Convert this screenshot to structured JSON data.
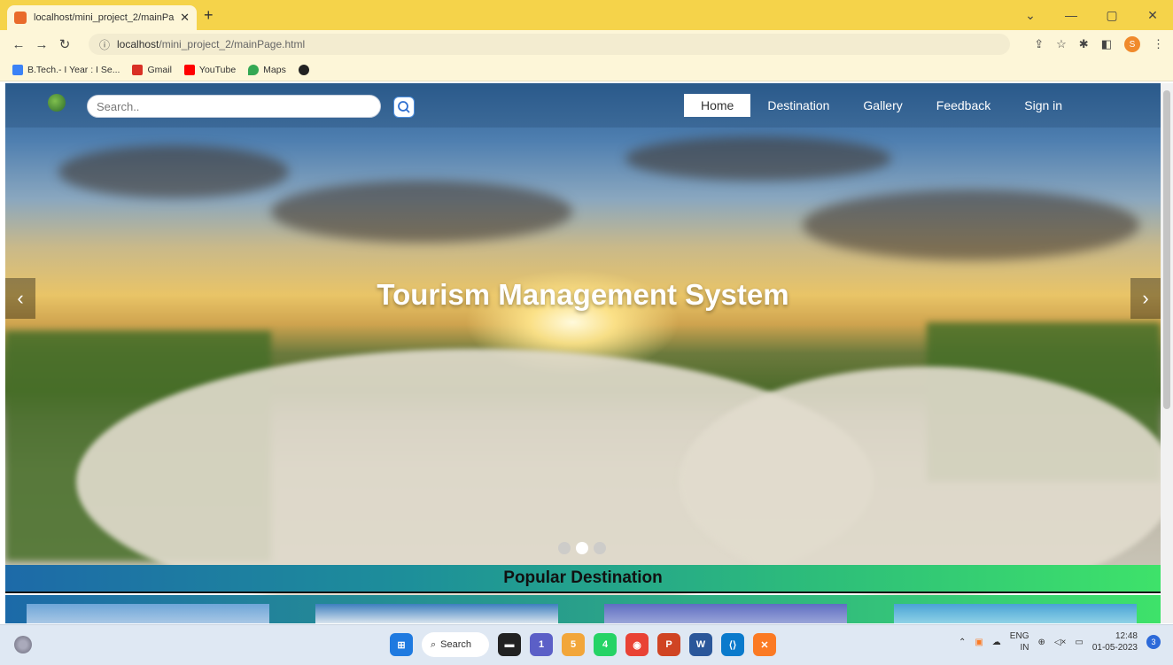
{
  "browser": {
    "tab_title": "localhost/mini_project_2/mainPa",
    "url_host": "localhost",
    "url_path": "/mini_project_2/mainPage.html",
    "bookmarks": [
      {
        "label": "B.Tech.- I Year : I Se...",
        "icon": "classroom-icon",
        "color": "#3b82f6"
      },
      {
        "label": "Gmail",
        "icon": "gmail-icon",
        "color": "#d93025"
      },
      {
        "label": "YouTube",
        "icon": "youtube-icon",
        "color": "#ff0000"
      },
      {
        "label": "Maps",
        "icon": "maps-icon",
        "color": "#34a853"
      }
    ],
    "profile_initial": "S"
  },
  "site": {
    "search_placeholder": "Search..",
    "nav": [
      "Home",
      "Destination",
      "Gallery",
      "Feedback",
      "Sign in"
    ],
    "active_nav": "Home",
    "hero_title": "Tourism Management System",
    "prev_arrow": "‹",
    "next_arrow": "›",
    "section_title": "Popular Destination"
  },
  "taskbar": {
    "search_label": "Search",
    "lang_top": "ENG",
    "lang_bottom": "IN",
    "time": "12:48",
    "date": "01-05-2023",
    "notification_count": "3",
    "badges": [
      "5",
      "1",
      "4"
    ]
  },
  "colors": {
    "tabstrip": "#f5d34a",
    "toolbar": "#fdf6d8",
    "section_gradient_start": "#1d6aa8",
    "section_gradient_end": "#3ee26a"
  }
}
